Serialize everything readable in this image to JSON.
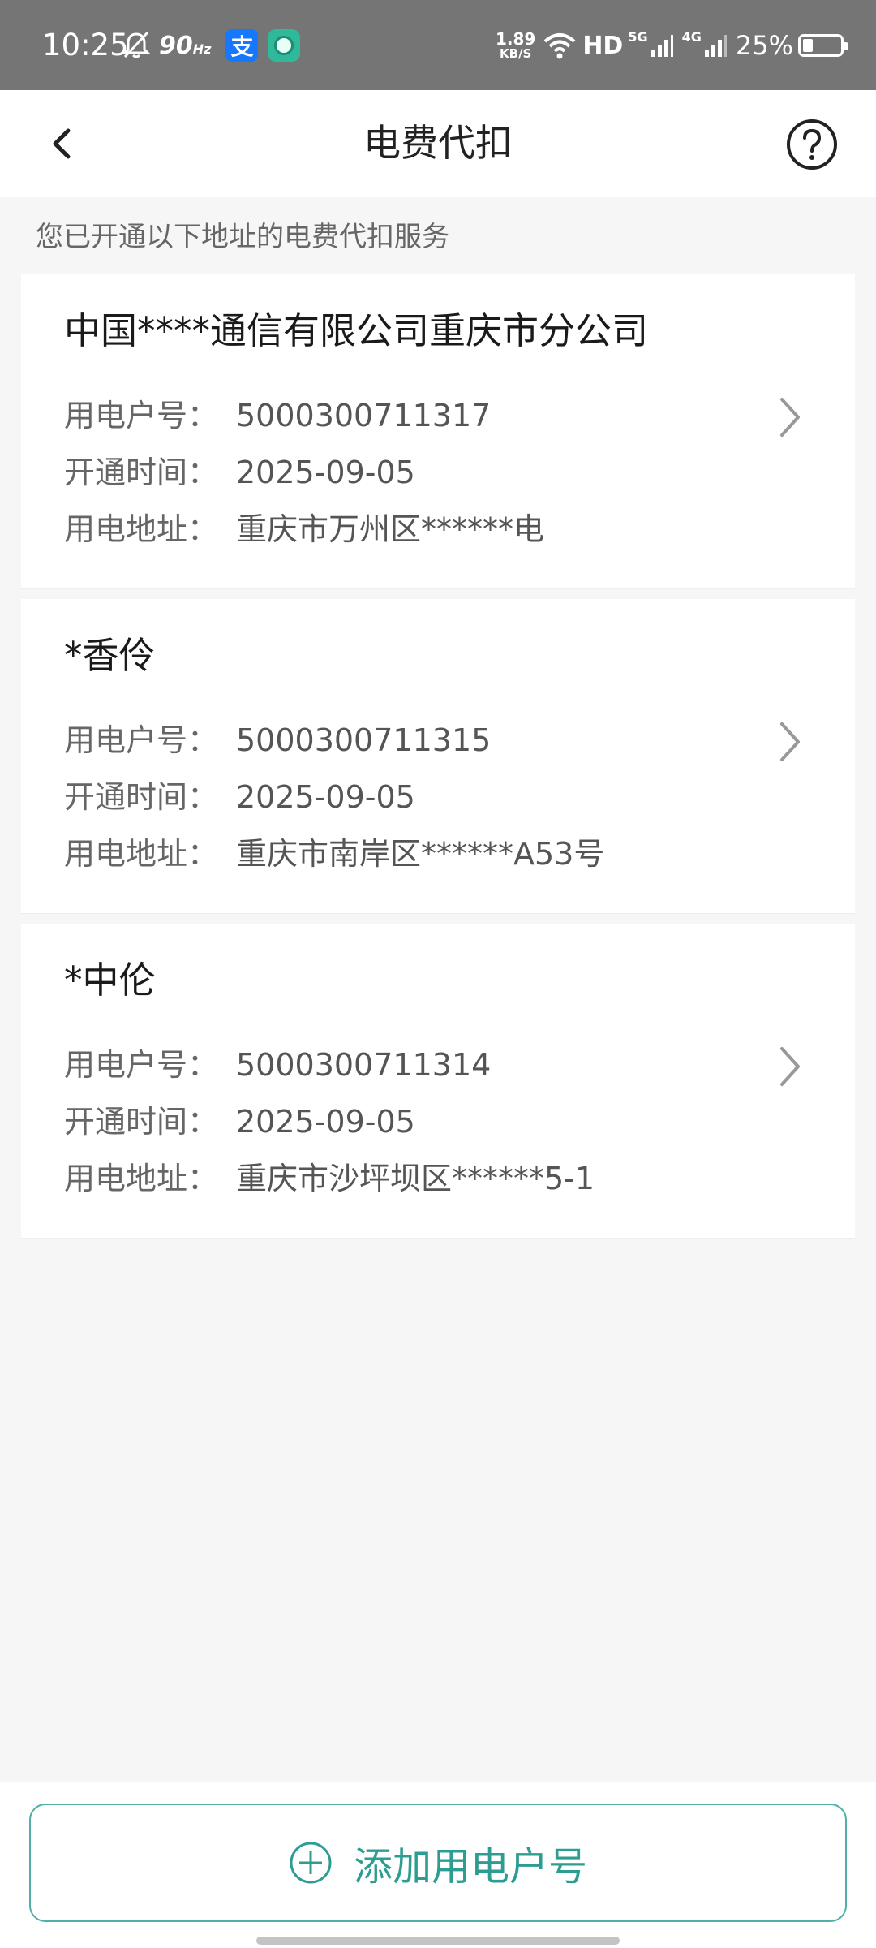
{
  "status_bar": {
    "time": "10:25",
    "refresh_rate": "90",
    "refresh_unit": "Hz",
    "alipay_glyph": "支",
    "net_speed": "1.89",
    "net_speed_unit": "KB/S",
    "hd_label": "HD",
    "net_5g": "5G",
    "net_4g": "4G",
    "battery": "25%"
  },
  "nav": {
    "title": "电费代扣",
    "back_icon": "chevron-left-icon",
    "help_icon": "question-circle-icon"
  },
  "subtitle": "您已开通以下地址的电费代扣服务",
  "labels": {
    "account": "用电户号：",
    "opened": "开通时间：",
    "address": "用电地址："
  },
  "cards": [
    {
      "name": "中国****通信有限公司重庆市分公司",
      "account": "5000300711317",
      "opened": "2025-09-05",
      "address": "重庆市万州区******电"
    },
    {
      "name": "*香伶",
      "account": "5000300711315",
      "opened": "2025-09-05",
      "address": "重庆市南岸区******A53号"
    },
    {
      "name": "*中伦",
      "account": "5000300711314",
      "opened": "2025-09-05",
      "address": "重庆市沙坪坝区******5-1"
    }
  ],
  "add_button": {
    "label": "添加用电户号",
    "icon": "plus-circle-icon"
  },
  "colors": {
    "accent": "#2e9d91",
    "status_bar": "#757575"
  }
}
